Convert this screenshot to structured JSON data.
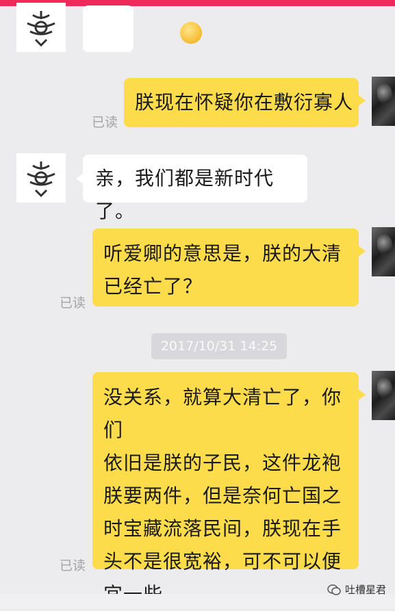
{
  "chat": {
    "messages": [
      {
        "side": "left",
        "content": "smiley-emoji"
      },
      {
        "side": "right",
        "text": "朕现在怀疑你在敷衍寡人",
        "status": "已读"
      },
      {
        "side": "left",
        "text": "亲，我们都是新时代了。"
      },
      {
        "side": "right",
        "text_lines": [
          "听爱卿的意思是，朕的大清",
          "已经亡了？"
        ],
        "status": "已读"
      },
      {
        "side": "right",
        "text_lines": [
          "没关系，就算大清亡了，你们",
          "依旧是朕的子民，这件龙袍",
          "朕要两件，但是奈何亡国之",
          "时宝藏流落民间，朕现在手",
          "头不是很宽裕，可不可以便",
          "宜一些"
        ],
        "status": "已读"
      }
    ],
    "timestamp": "2017/10/31 14:25"
  },
  "watermark": {
    "icon": "wechat-icon",
    "text": "吐槽星君"
  },
  "colors": {
    "top_bar": "#ee2a5a",
    "bubble_mine": "#fddc4c",
    "bubble_other": "#ffffff",
    "background": "#ececee"
  }
}
